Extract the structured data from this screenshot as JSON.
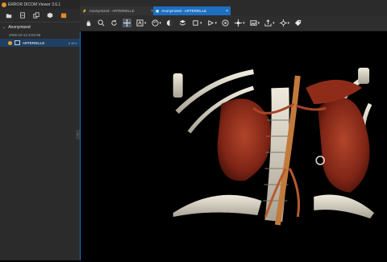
{
  "app": {
    "title": "ERROR DICOM Viewer 3.6.1"
  },
  "sidebar": {
    "toolbar": [
      "open-folder-icon",
      "import-icon",
      "copy-icon",
      "cube-icon",
      "folder-color-icon"
    ],
    "patient": {
      "name": "Anonymized",
      "expanded": true
    },
    "study_date": "2006-10-12 9:02:58",
    "series": {
      "label": "ARTERIELLE",
      "count": "# 16:1"
    }
  },
  "tabs": [
    {
      "label": "Anonymized - ARTERIELLE",
      "active": false
    },
    {
      "label": "Anonymized - ARTERIELLE",
      "active": true
    }
  ],
  "toolbar": {
    "tools": [
      "hand-icon",
      "zoom-icon",
      "rotate-icon",
      "pan-icon",
      "annotation-icon",
      "palette-icon",
      "window-level-icon",
      "layers-icon",
      "crop-icon",
      "measure-icon",
      "play-icon",
      "mpr-icon",
      "image-icon",
      "export-icon",
      "settings-icon",
      "tag-icon"
    ],
    "selected": "pan-icon"
  },
  "colors": {
    "accent": "#1d6fc0",
    "panel": "#2b2b2b",
    "tissue": "#8a2a1a",
    "bone": "#d8d4c6"
  }
}
